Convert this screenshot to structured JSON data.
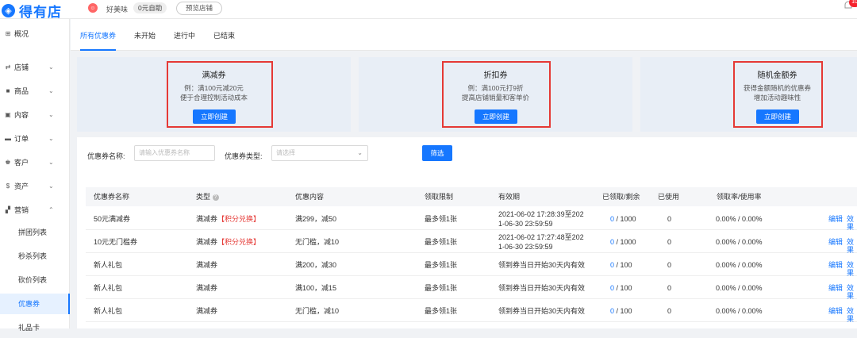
{
  "header": {
    "logo_mark": "◈",
    "brand": "得有店",
    "shop_avatar": "☺",
    "shop_name": "好美味",
    "plan": "0元自助",
    "preview": "预览店铺",
    "notification_count": "10"
  },
  "sidebar": {
    "items": [
      {
        "label": "概况",
        "icon": "grid-icon",
        "glyph": "⊞"
      },
      {
        "label": "店铺",
        "icon": "store-icon",
        "glyph": "⇄"
      },
      {
        "label": "商品",
        "icon": "goods-icon",
        "glyph": "■"
      },
      {
        "label": "内容",
        "icon": "content-icon",
        "glyph": "▣"
      },
      {
        "label": "订单",
        "icon": "order-icon",
        "glyph": "▬"
      },
      {
        "label": "客户",
        "icon": "customer-icon",
        "glyph": "♚"
      },
      {
        "label": "资产",
        "icon": "asset-icon",
        "glyph": "$"
      },
      {
        "label": "营销",
        "icon": "marketing-icon",
        "glyph": "▞"
      }
    ],
    "sub_items": [
      "拼团列表",
      "秒杀列表",
      "砍价列表",
      "优惠券",
      "礼品卡"
    ]
  },
  "tabs": [
    "所有优惠券",
    "未开始",
    "进行中",
    "已结束"
  ],
  "cards": [
    {
      "title": "满减券",
      "desc1": "例：满100元减20元",
      "desc2": "便于合理控制活动成本",
      "button": "立即创建"
    },
    {
      "title": "折扣券",
      "desc1": "例：满100元打9折",
      "desc2": "提高店铺销量和客单价",
      "button": "立即创建"
    },
    {
      "title": "随机金额券",
      "desc1": "获得金额随机的优惠券",
      "desc2": "增加活动趣味性",
      "button": "立即创建"
    }
  ],
  "filter": {
    "name_label": "优惠券名称:",
    "name_placeholder": "请输入优惠券名称",
    "type_label": "优惠券类型:",
    "type_placeholder": "请选择",
    "search": "筛选"
  },
  "table": {
    "columns": [
      "优惠券名称",
      "类型",
      "优惠内容",
      "领取限制",
      "有效期",
      "已领取/剩余",
      "已使用",
      "领取率/使用率"
    ],
    "rows": [
      {
        "name": "50元满减券",
        "type": "满减券",
        "tag": "【积分兑换】",
        "content": "满299，减50",
        "limit": "最多领1张",
        "valid1": "2021-06-02 17:28:39至202",
        "valid2": "1-06-30 23:59:59",
        "received": "0",
        "remain": "/ 1000",
        "used": "0",
        "rate": "0.00% / 0.00%",
        "edit": "编辑",
        "effect": "效果"
      },
      {
        "name": "10元无门槛券",
        "type": "满减券",
        "tag": "【积分兑换】",
        "content": "无门槛，减10",
        "limit": "最多领1张",
        "valid1": "2021-06-02 17:27:48至202",
        "valid2": "1-06-30 23:59:59",
        "received": "0",
        "remain": "/ 1000",
        "used": "0",
        "rate": "0.00% / 0.00%",
        "edit": "编辑",
        "effect": "效果"
      },
      {
        "name": "新人礼包",
        "type": "满减券",
        "tag": "",
        "content": "满200，减30",
        "limit": "最多领1张",
        "valid1": "领到券当日开始30天内有效",
        "valid2": "",
        "received": "0",
        "remain": "/ 100",
        "used": "0",
        "rate": "0.00% / 0.00%",
        "edit": "编辑",
        "effect": "效果"
      },
      {
        "name": "新人礼包",
        "type": "满减券",
        "tag": "",
        "content": "满100，减15",
        "limit": "最多领1张",
        "valid1": "领到券当日开始30天内有效",
        "valid2": "",
        "received": "0",
        "remain": "/ 100",
        "used": "0",
        "rate": "0.00% / 0.00%",
        "edit": "编辑",
        "effect": "效果"
      },
      {
        "name": "新人礼包",
        "type": "满减券",
        "tag": "",
        "content": "无门槛，减10",
        "limit": "最多领1张",
        "valid1": "领到券当日开始30天内有效",
        "valid2": "",
        "received": "0",
        "remain": "/ 100",
        "used": "0",
        "rate": "0.00% / 0.00%",
        "edit": "编辑",
        "effect": "效果"
      }
    ]
  }
}
